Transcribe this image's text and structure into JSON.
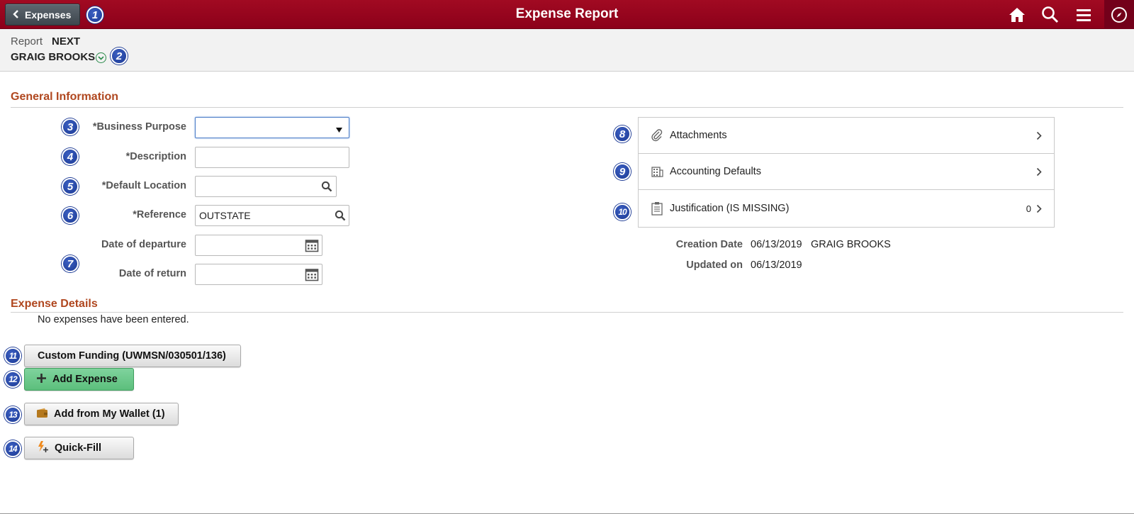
{
  "header": {
    "back_label": "Expenses",
    "title": "Expense Report",
    "icons": [
      "home-icon",
      "search-icon",
      "menu-icon",
      "compass-icon"
    ],
    "bar_color": "#960c22"
  },
  "report": {
    "label": "Report",
    "value": "NEXT",
    "employee": "GRAIG BROOKS"
  },
  "callouts": [
    "1",
    "2",
    "3",
    "4",
    "5",
    "6",
    "7",
    "8",
    "9",
    "10",
    "11",
    "12",
    "13",
    "14"
  ],
  "general": {
    "title": "General Information",
    "fields": {
      "business_purpose": {
        "label": "*Business Purpose",
        "value": ""
      },
      "description": {
        "label": "*Description",
        "value": ""
      },
      "default_location": {
        "label": "*Default Location",
        "value": ""
      },
      "reference": {
        "label": "*Reference",
        "value": "OUTSTATE"
      },
      "departure": {
        "label": "Date of departure",
        "value": ""
      },
      "return": {
        "label": "Date of return",
        "value": ""
      }
    }
  },
  "panels": {
    "attachments": {
      "label": "Attachments"
    },
    "accounting": {
      "label": "Accounting Defaults"
    },
    "justification": {
      "label": "Justification (IS MISSING)",
      "count": "0"
    }
  },
  "meta": {
    "creation_label": "Creation Date",
    "creation_date": "06/13/2019",
    "creation_by": "GRAIG BROOKS",
    "updated_label": "Updated on",
    "updated_date": "06/13/2019"
  },
  "expense_details": {
    "title": "Expense Details",
    "empty_message": "No expenses have been entered.",
    "buttons": {
      "custom_funding": "Custom Funding (UWMSN/030501/136)",
      "add_expense": "Add Expense",
      "add_wallet": "Add from My Wallet (1)",
      "quick_fill": "Quick-Fill"
    }
  }
}
